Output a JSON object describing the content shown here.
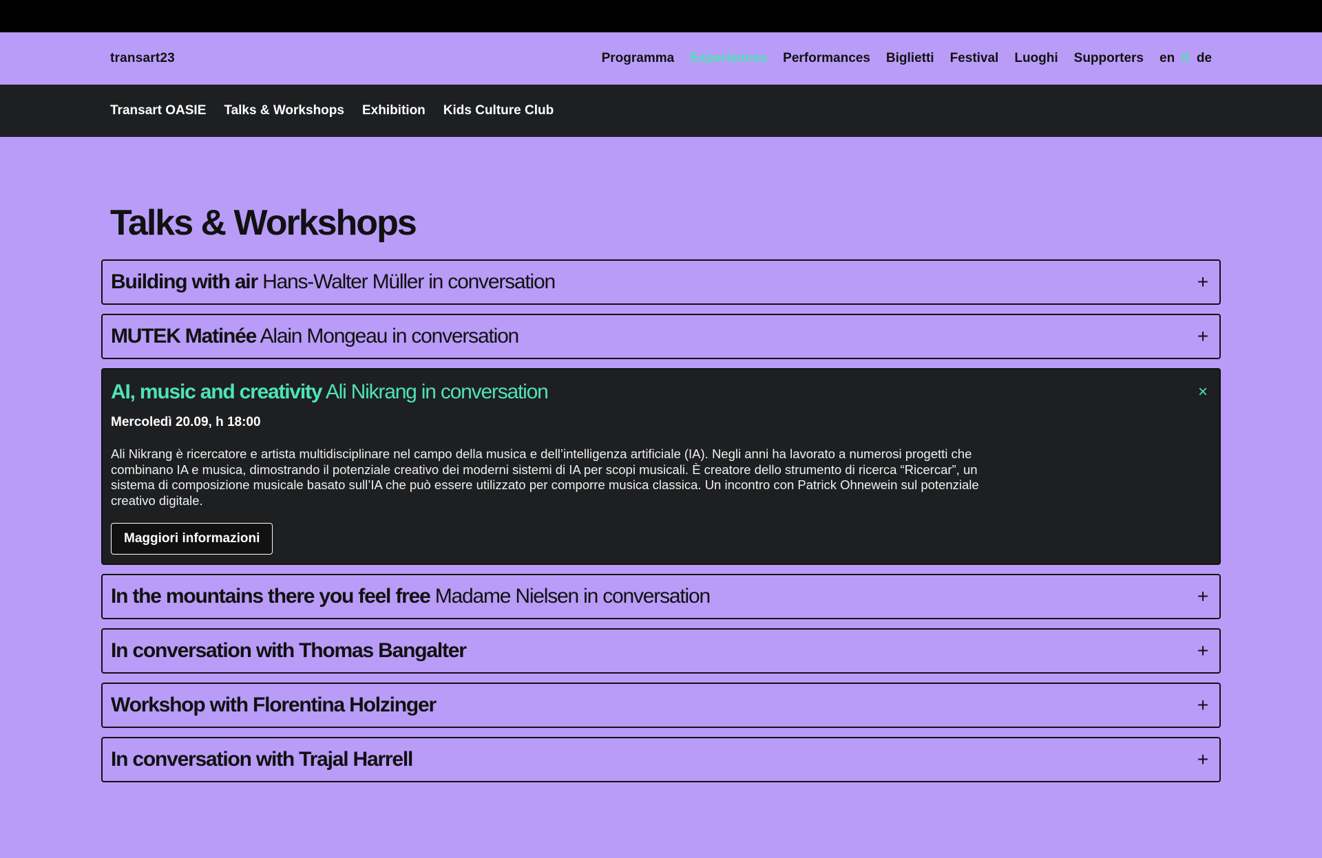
{
  "header": {
    "brand": "transart23",
    "menu": [
      "Programma",
      "Experiences",
      "Performances",
      "Biglietti",
      "Festival",
      "Luoghi",
      "Supporters"
    ],
    "active_menu": "Experiences",
    "languages": [
      "en",
      "it",
      "de"
    ],
    "active_language": "it"
  },
  "subnav": {
    "items": [
      "Transart OASIE",
      "Talks & Workshops",
      "Exhibition",
      "Kids Culture Club"
    ]
  },
  "page": {
    "title": "Talks & Workshops"
  },
  "accordion": {
    "items": [
      {
        "title": "Building with air",
        "subtitle": "Hans-Walter Müller in conversation",
        "toggle": "+"
      },
      {
        "title": "MUTEK Matinée",
        "subtitle": "Alain Mongeau in conversation",
        "toggle": "+"
      },
      {
        "title": "AI, music and creativity",
        "subtitle": "Ali Nikrang in conversation",
        "toggle": "×",
        "date": "Mercoledì 20.09, h 18:00",
        "description": "Ali Nikrang è ricercatore e artista multidisciplinare nel campo della musica e dell’intelligenza artificiale (IA). Negli anni ha lavorato a numerosi progetti che combinano IA e musica, dimostrando il potenziale creativo dei moderni sistemi di IA per scopi musicali. È creatore dello strumento di ricerca “Ricercar”, un sistema di composizione musicale basato sull’IA che può essere utilizzato per comporre musica classica. Un incontro con Patrick Ohnewein sul potenziale creativo digitale.",
        "button": "Maggiori informazioni"
      },
      {
        "title": "In the mountains there you feel free",
        "subtitle": "Madame Nielsen in conversation",
        "toggle": "+"
      },
      {
        "title": "In conversation with Thomas Bangalter",
        "subtitle": "",
        "toggle": "+"
      },
      {
        "title": "Workshop with Florentina Holzinger",
        "subtitle": "",
        "toggle": "+"
      },
      {
        "title": "In conversation with Trajal Harrell",
        "subtitle": "",
        "toggle": "+"
      }
    ]
  },
  "colors": {
    "background": "#b99cf8",
    "dark": "#1e1f21",
    "accent": "#4de3b8"
  }
}
